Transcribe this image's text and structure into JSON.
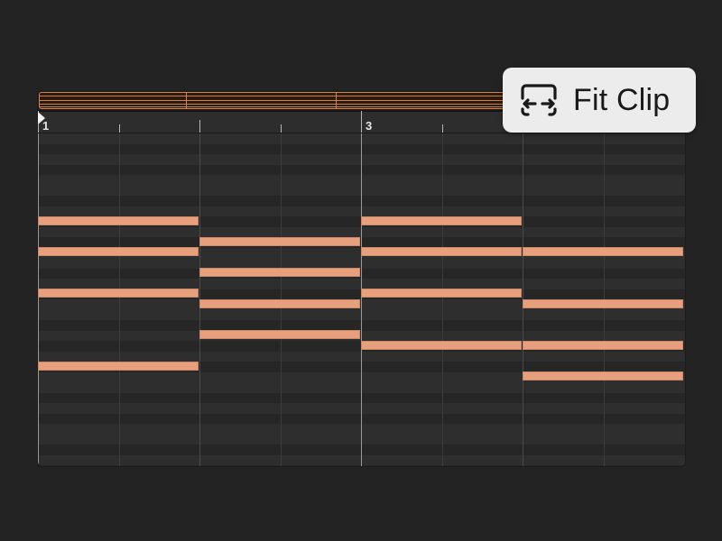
{
  "editor": {
    "ruler_labels": [
      {
        "text": "1",
        "bar": 1
      },
      {
        "text": "3",
        "bar": 3
      }
    ]
  },
  "fit_clip_button": {
    "label": "Fit Clip",
    "icon": "fit-clip-icon"
  },
  "notes": [
    {
      "beat_start": 0,
      "length_beats": 2,
      "pitch_row": 0
    },
    {
      "beat_start": 0,
      "length_beats": 2,
      "pitch_row": 1
    },
    {
      "beat_start": 0,
      "length_beats": 2,
      "pitch_row": 2
    },
    {
      "beat_start": 0,
      "length_beats": 2,
      "pitch_row": 4
    },
    {
      "beat_start": 2,
      "length_beats": 2,
      "pitch_row": 3
    },
    {
      "beat_start": 2,
      "length_beats": 2,
      "pitch_row": 5
    },
    {
      "beat_start": 2,
      "length_beats": 2,
      "pitch_row": 6
    },
    {
      "beat_start": 2,
      "length_beats": 2,
      "pitch_row": 7
    },
    {
      "beat_start": 4,
      "length_beats": 2,
      "pitch_row": 0
    },
    {
      "beat_start": 4,
      "length_beats": 2,
      "pitch_row": 1
    },
    {
      "beat_start": 4,
      "length_beats": 2,
      "pitch_row": 2
    },
    {
      "beat_start": 4,
      "length_beats": 2,
      "pitch_row": 8
    },
    {
      "beat_start": 6,
      "length_beats": 2,
      "pitch_row": 1
    },
    {
      "beat_start": 6,
      "length_beats": 2,
      "pitch_row": 9
    },
    {
      "beat_start": 6,
      "length_beats": 2,
      "pitch_row": 8
    },
    {
      "beat_start": 6,
      "length_beats": 2,
      "pitch_row": 10
    }
  ],
  "colors": {
    "note_fill": "#e8a07c",
    "clip_accent": "#d7834a",
    "background": "#232323"
  }
}
